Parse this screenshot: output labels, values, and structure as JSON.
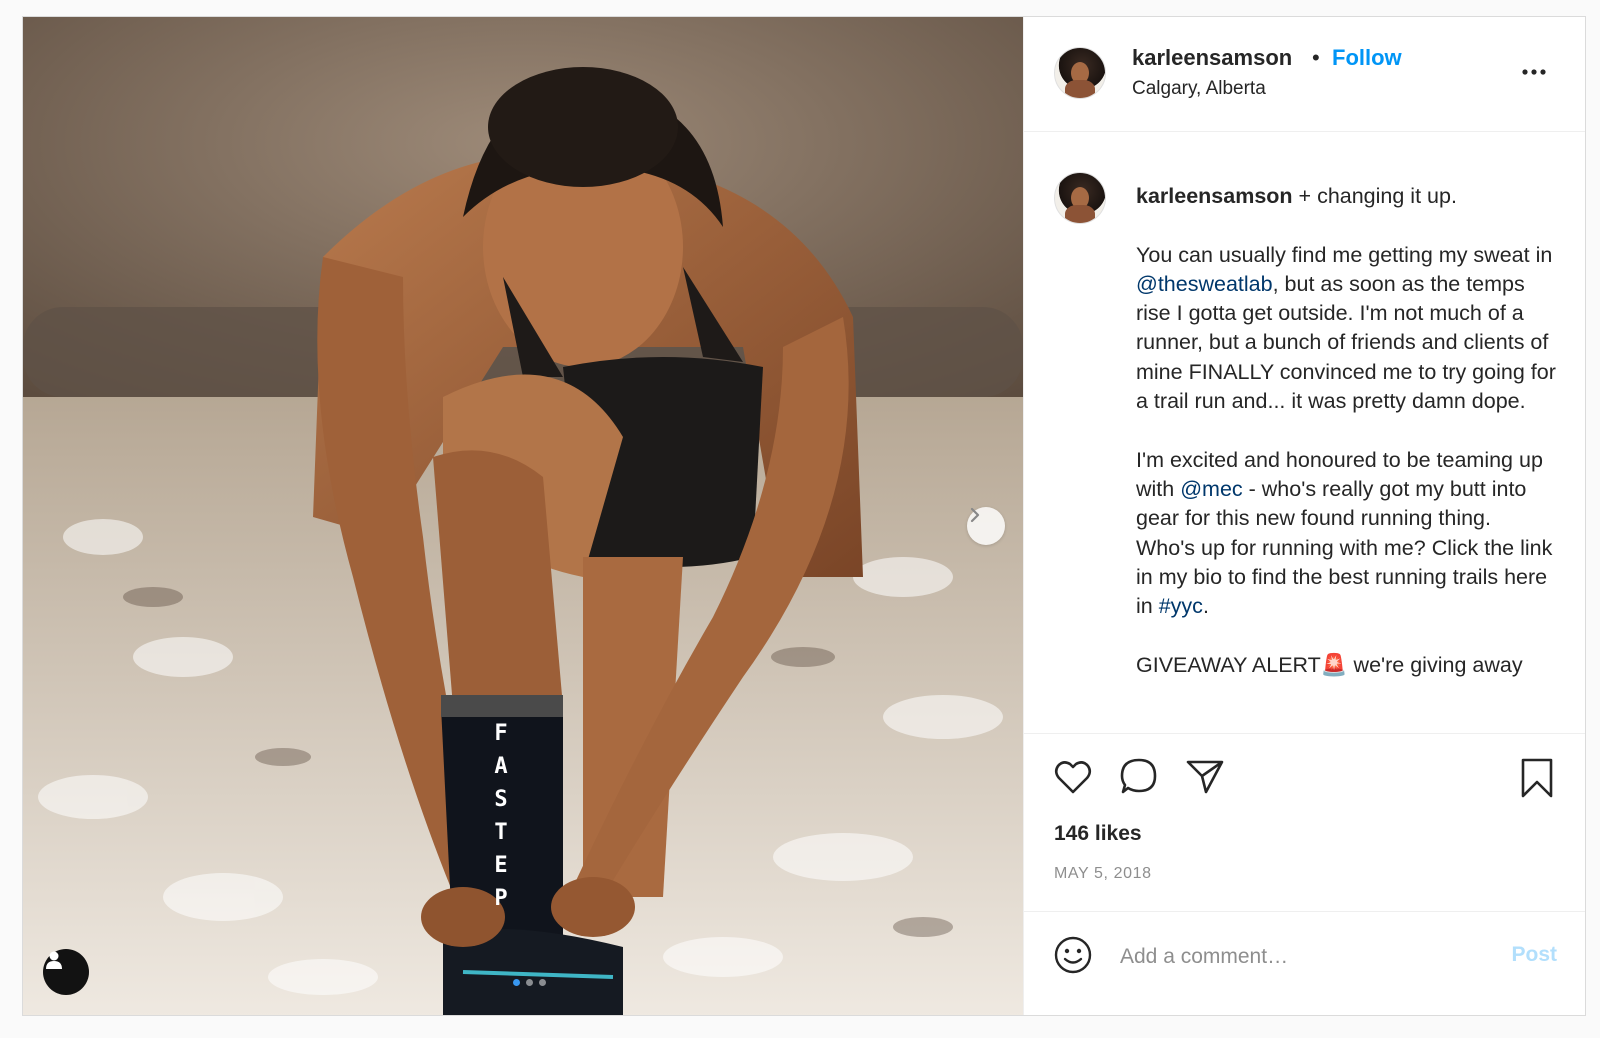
{
  "post": {
    "username": "karleensamson",
    "separator": "•",
    "follow_label": "Follow",
    "location": "Calgary, Alberta",
    "more_label": "...",
    "media": {
      "sock_text": "FASTEP",
      "carousel_count": 3,
      "carousel_active": 1
    },
    "caption": {
      "username": "karleensamson",
      "line1": " + changing it up.\n\nYou can usually find me getting my sweat in ",
      "mention1": "@thesweatlab",
      "line2": ", but as soon as the temps rise I gotta get outside. I'm not much of a runner, but a bunch of friends and clients of mine FINALLY convinced me to try going for a trail run and... it was pretty damn dope.\n\nI'm excited and honoured to be teaming up with ",
      "mention2": "@mec",
      "line3": " - who's really got my butt into gear for this new found running thing. Who's up for running with me? Click the link in my bio to find the best running trails here in ",
      "hashtag": "#yyc",
      "line4": ".\n\nGIVEAWAY ALERT🚨 we're giving away"
    },
    "likes": "146 likes",
    "date": "MAY 5, 2018",
    "comment": {
      "placeholder": "Add a comment…",
      "value": "",
      "post_label": "Post"
    }
  },
  "colors": {
    "follow": "#0095f6",
    "mention": "#00376b",
    "post_disabled": "#b2dffc",
    "carousel_active": "#3897f0"
  },
  "icons": [
    "chevron-right-icon",
    "user-tag-icon",
    "more-icon",
    "heart-icon",
    "comment-icon",
    "share-icon",
    "bookmark-icon",
    "emoji-icon"
  ]
}
